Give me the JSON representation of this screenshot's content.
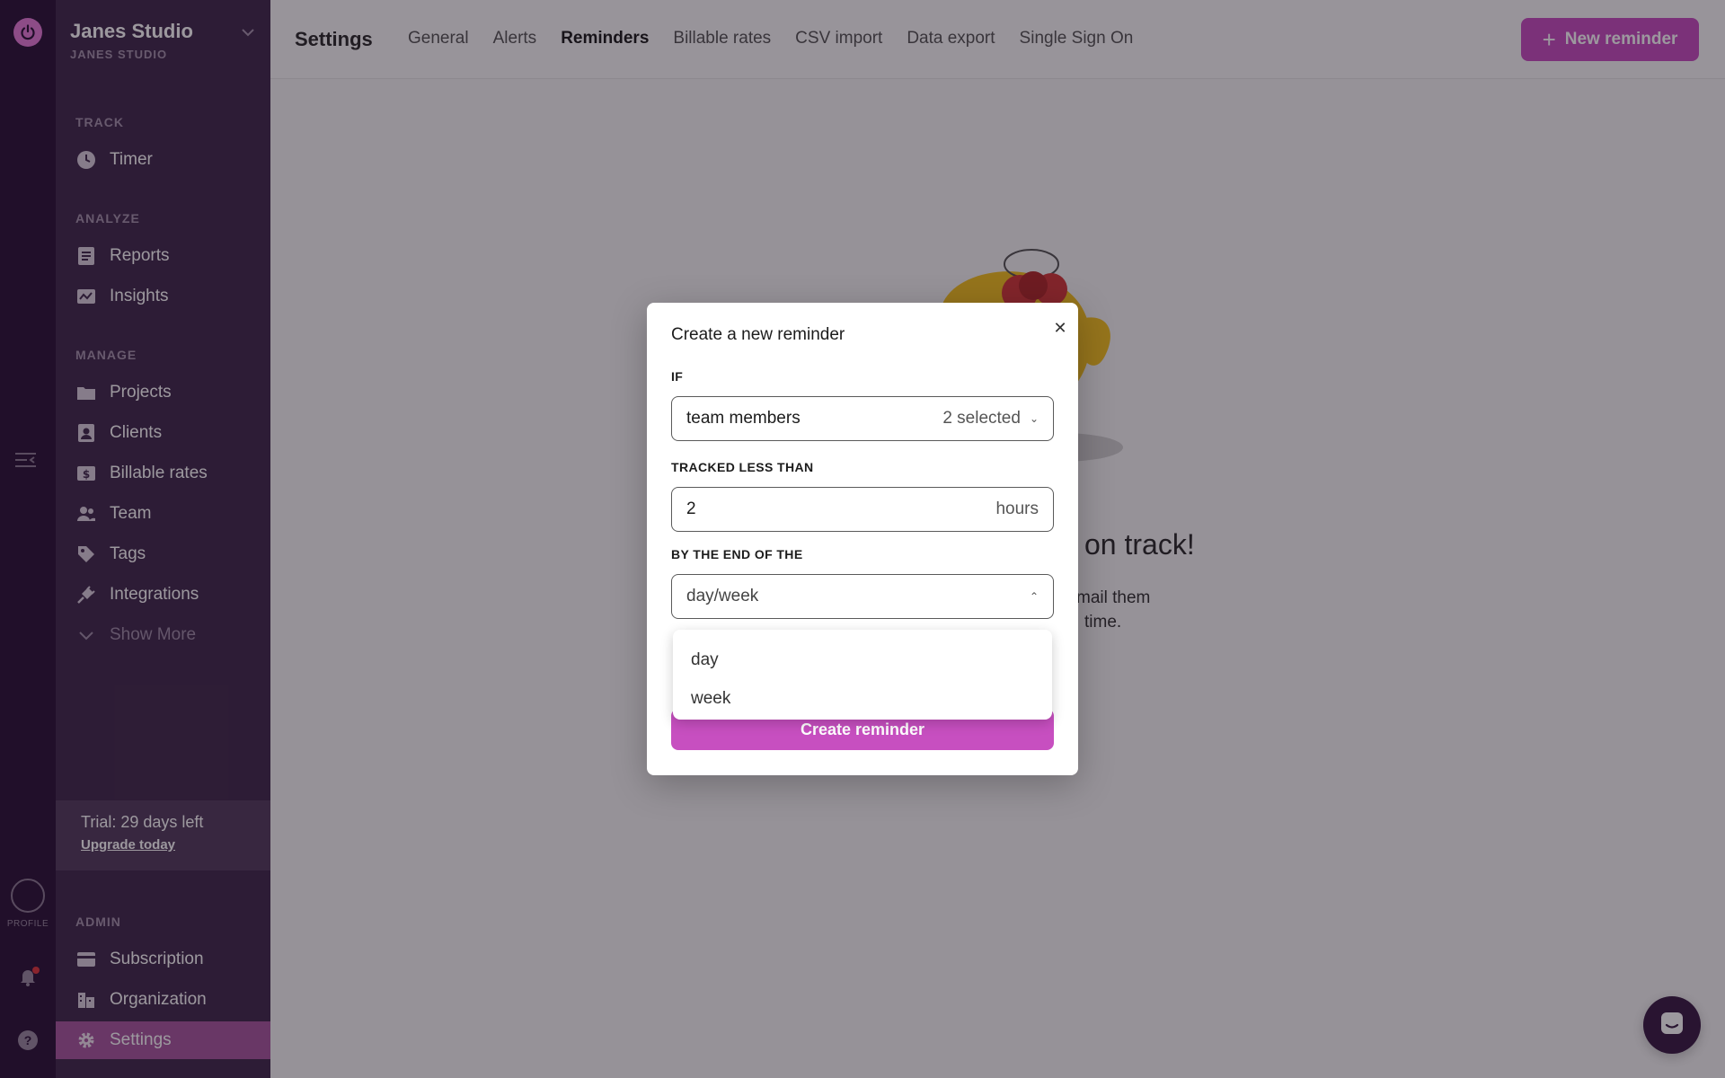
{
  "workspace": {
    "name": "Janes Studio",
    "subtitle": "JANES STUDIO"
  },
  "rail": {
    "profile_label": "PROFILE"
  },
  "sidebar": {
    "sections": {
      "track": "TRACK",
      "analyze": "ANALYZE",
      "manage": "MANAGE",
      "admin": "ADMIN"
    },
    "track_items": [
      {
        "label": "Timer",
        "icon": "clock-icon"
      }
    ],
    "analyze_items": [
      {
        "label": "Reports",
        "icon": "document-icon"
      },
      {
        "label": "Insights",
        "icon": "chart-image-icon"
      }
    ],
    "manage_items": [
      {
        "label": "Projects",
        "icon": "folder-icon"
      },
      {
        "label": "Clients",
        "icon": "contact-card-icon"
      },
      {
        "label": "Billable rates",
        "icon": "dollar-icon"
      },
      {
        "label": "Team",
        "icon": "people-icon"
      },
      {
        "label": "Tags",
        "icon": "tag-icon"
      },
      {
        "label": "Integrations",
        "icon": "plug-icon"
      },
      {
        "label": "Show More",
        "icon": "chevron-down-icon"
      }
    ],
    "trial": {
      "text": "Trial: 29 days left",
      "link": "Upgrade today"
    },
    "admin_items": [
      {
        "label": "Subscription",
        "icon": "credit-card-icon"
      },
      {
        "label": "Organization",
        "icon": "building-icon"
      },
      {
        "label": "Settings",
        "icon": "gear-icon",
        "active": true
      }
    ]
  },
  "header": {
    "title": "Settings",
    "tabs": [
      {
        "label": "General"
      },
      {
        "label": "Alerts"
      },
      {
        "label": "Reminders",
        "active": true
      },
      {
        "label": "Billable rates"
      },
      {
        "label": "CSV import"
      },
      {
        "label": "Data export"
      },
      {
        "label": "Single Sign On"
      }
    ],
    "new_button": "New reminder"
  },
  "empty_state": {
    "title_fragment": "on track!",
    "line1_fragment": "mail them",
    "line2_fragment": "time."
  },
  "modal": {
    "title": "Create a new reminder",
    "if_label": "IF",
    "if_value": "team members",
    "if_selected": "2 selected",
    "tracked_label": "TRACKED LESS THAN",
    "tracked_value": "2",
    "tracked_unit": "hours",
    "period_label": "BY THE END OF THE",
    "period_value": "day/week",
    "period_options": [
      "day",
      "week"
    ],
    "submit": "Create reminder"
  },
  "colors": {
    "accent": "#c74fc0",
    "sidebar": "#412a4c",
    "rail": "#2c1338",
    "active_nav": "#a7599f"
  }
}
